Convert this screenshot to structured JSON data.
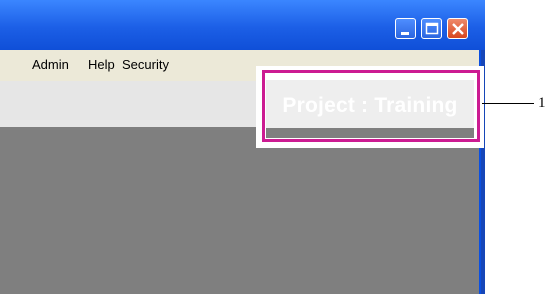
{
  "menubar": {
    "items": [
      {
        "label": "Admin"
      },
      {
        "label": "Help"
      },
      {
        "label": "Security"
      }
    ]
  },
  "header": {
    "project_title": "Project : Training"
  },
  "callout": {
    "number": "1",
    "highlight_color": "#cc1b92"
  },
  "icons": {
    "minimize": "minimize-icon",
    "maximize": "maximize-icon",
    "close": "close-icon"
  },
  "colors": {
    "titlebar": "#1c5fe6",
    "menubar": "#ece9d8",
    "content": "#7f7f7f"
  }
}
